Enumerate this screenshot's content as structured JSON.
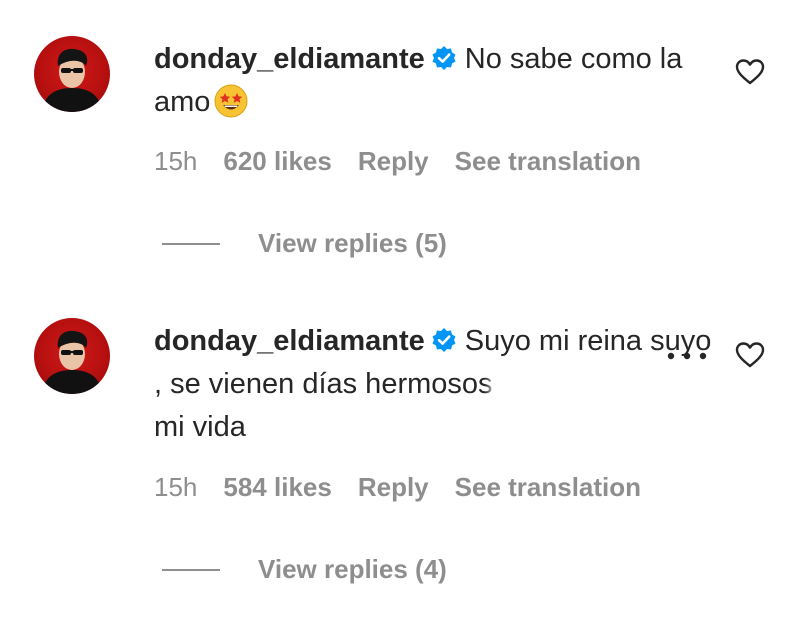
{
  "comments": [
    {
      "username": "donday_eldiamante",
      "text": "No sabe como la amo",
      "emoji": "star-struck-emoji",
      "time": "15h",
      "likes": "620 likes",
      "reply_label": "Reply",
      "translate_label": "See translation",
      "view_replies": "View replies (5)"
    },
    {
      "username": "donday_eldiamante",
      "text_main": "Suyo mi reina suyo , se vienen días hermo",
      "text_faded": "sos",
      "text_end": "mi vida",
      "time": "15h",
      "likes": "584 likes",
      "reply_label": "Reply",
      "translate_label": "See translation",
      "view_replies": "View replies (4)"
    }
  ],
  "icons": {
    "verified": "verified-badge-icon",
    "like": "heart-outline-icon",
    "more": "more-options-icon"
  },
  "colors": {
    "verified_blue": "#0095f6",
    "text": "#262626",
    "secondary": "#8e8e8e",
    "avatar_red": "#c41414"
  }
}
